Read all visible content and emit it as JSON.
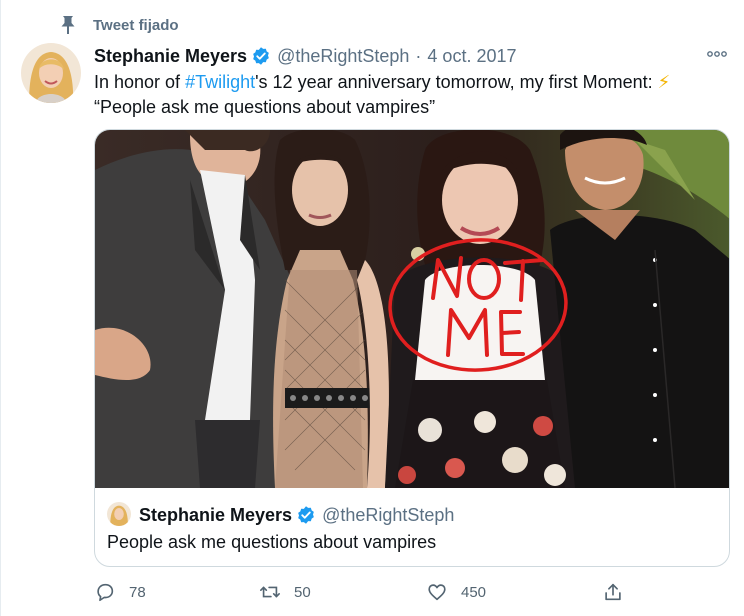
{
  "pinned": {
    "label": "Tweet fijado",
    "icon": "pin-icon"
  },
  "author": {
    "display_name": "Stephanie Meyers",
    "handle": "@theRightSteph",
    "separator": "·",
    "date": "4 oct. 2017",
    "verified_icon": "verified-badge-icon"
  },
  "tweet": {
    "text_before": "In honor of ",
    "hashtag": "#Twilight",
    "text_after": "'s 12 year anniversary tomorrow, my first Moment: ",
    "emoji": "⚡",
    "line2": "“People ask me questions about vampires”"
  },
  "photo": {
    "annotation": "NOT ME",
    "annotation_line1": "NOT",
    "annotation_line2": "ME",
    "annotation_color": "#e01f1f"
  },
  "quote": {
    "display_name": "Stephanie Meyers",
    "handle": "@theRightSteph",
    "text": "People ask me questions about vampires"
  },
  "actions": {
    "reply": {
      "icon": "reply-icon",
      "count": "78"
    },
    "retweet": {
      "icon": "retweet-icon",
      "count": "50"
    },
    "like": {
      "icon": "heart-icon",
      "count": "450"
    },
    "share": {
      "icon": "share-icon"
    }
  },
  "colors": {
    "accent": "#1d9bf0",
    "secondary_text": "#5b7083",
    "border": "#cfd9de"
  }
}
